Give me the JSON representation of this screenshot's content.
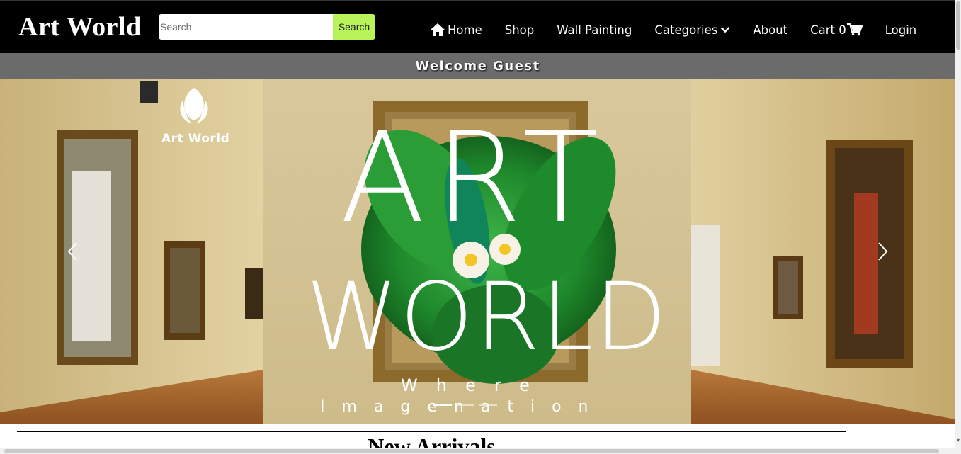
{
  "header": {
    "brand": "Art World",
    "search": {
      "placeholder": "Search",
      "value": "",
      "button_label": "Search"
    },
    "nav": {
      "home": "Home",
      "shop": "Shop",
      "wall_painting": "Wall Painting",
      "categories": "Categories",
      "about": "About",
      "cart": "Cart 0",
      "login": "Login"
    },
    "icons": {
      "home": "home-icon",
      "categories": "chevron-down-icon",
      "cart": "shopping-cart-icon"
    },
    "colors": {
      "background": "#000000",
      "search_button": "#b8f35a",
      "text": "#ffffff"
    }
  },
  "welcome": {
    "text": "Welcome Guest",
    "background": "#6b6b6b"
  },
  "carousel": {
    "logo_text": "Art World",
    "hero": {
      "line1": "ART",
      "line2": "WORLD",
      "line3": "Where",
      "line4": "Imagenation"
    },
    "active_slide": 1,
    "slide_count": 3,
    "controls": {
      "prev": "chevron-left-icon",
      "next": "chevron-right-icon"
    }
  },
  "section": {
    "title": "New Arrivals"
  }
}
